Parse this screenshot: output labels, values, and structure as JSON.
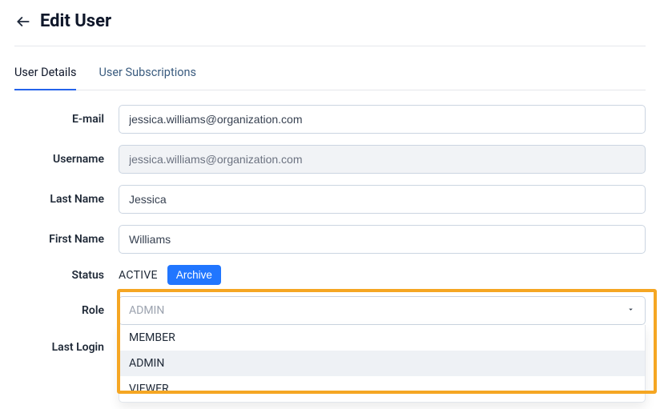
{
  "header": {
    "title": "Edit User"
  },
  "tabs": {
    "details": "User Details",
    "subscriptions": "User Subscriptions"
  },
  "labels": {
    "email": "E-mail",
    "username": "Username",
    "last_name": "Last Name",
    "first_name": "First Name",
    "status": "Status",
    "role": "Role",
    "last_login": "Last Login"
  },
  "values": {
    "email": "jessica.williams@organization.com",
    "username": "jessica.williams@organization.com",
    "last_name": "Jessica",
    "first_name": "Williams",
    "status": "ACTIVE",
    "archive_button": "Archive",
    "role_selected": "ADMIN"
  },
  "role_options": {
    "member": "MEMBER",
    "admin": "ADMIN",
    "viewer": "VIEWER"
  }
}
